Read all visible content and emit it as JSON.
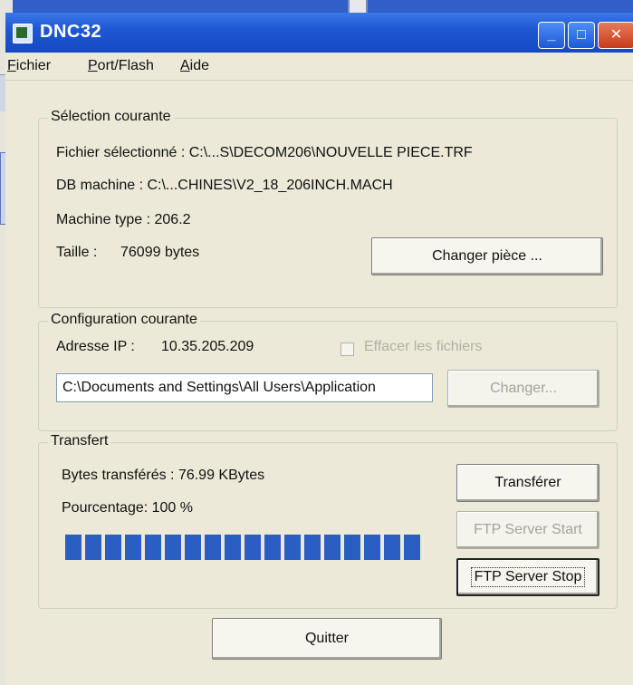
{
  "window": {
    "title": "DNC32"
  },
  "menu": [
    "Fichier",
    "Port/Flash",
    "Aide"
  ],
  "selection": {
    "title": "Sélection courante",
    "fichier": "Fichier sélectionné : C:\\...S\\DECOM206\\NOUVELLE PIECE.TRF",
    "db": "DB machine : C:\\...CHINES\\V2_18_206INCH.MACH",
    "machine_type": "Machine type : 206.2",
    "taille_label": "Taille :",
    "taille_value": "76099 bytes",
    "changer_piece": "Changer pièce ..."
  },
  "configuration": {
    "title": "Configuration courante",
    "ip_label": "Adresse IP :",
    "ip_value": "10.35.205.209",
    "effacer": "Effacer les fichiers",
    "path": "C:\\Documents and Settings\\All Users\\Application",
    "changer": "Changer..."
  },
  "transfert": {
    "title": "Transfert",
    "bytes": "Bytes transférés : 76.99 KBytes",
    "pourcentage": "Pourcentage: 100 %",
    "progress": 1.0,
    "transferer": "Transférer",
    "ftp_start": "FTP Server Start",
    "ftp_stop": "FTP Server Stop"
  },
  "quitter": "Quitter"
}
